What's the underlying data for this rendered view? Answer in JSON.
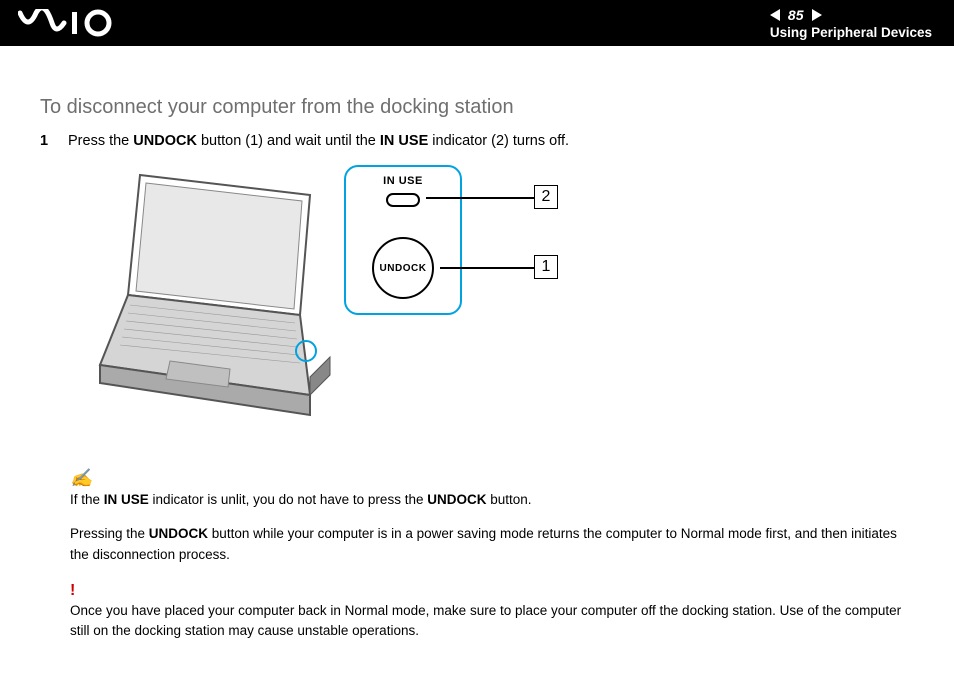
{
  "header": {
    "page_number": "85",
    "chapter": "Using Peripheral Devices"
  },
  "title": "To disconnect your computer from the docking station",
  "step": {
    "number": "1",
    "text_pre": "Press the ",
    "bold1": "UNDOCK",
    "text_mid": " button (1) and wait until the ",
    "bold2": "IN USE",
    "text_post": " indicator (2) turns off."
  },
  "inset": {
    "inuse_label": "IN USE",
    "undock_label": "UNDOCK",
    "callout1": "1",
    "callout2": "2"
  },
  "note1": {
    "pre": "If the ",
    "bold1": "IN USE",
    "mid": " indicator is unlit, you do not have to press the ",
    "bold2": "UNDOCK",
    "post": " button."
  },
  "note2": {
    "pre": "Pressing the ",
    "bold1": "UNDOCK",
    "post": " button while your computer is in a power saving mode returns the computer to Normal mode first, and then initiates the disconnection process."
  },
  "warning": "Once you have placed your computer back in Normal mode, make sure to place your computer off the docking station. Use of the computer still on the docking station may cause unstable operations."
}
